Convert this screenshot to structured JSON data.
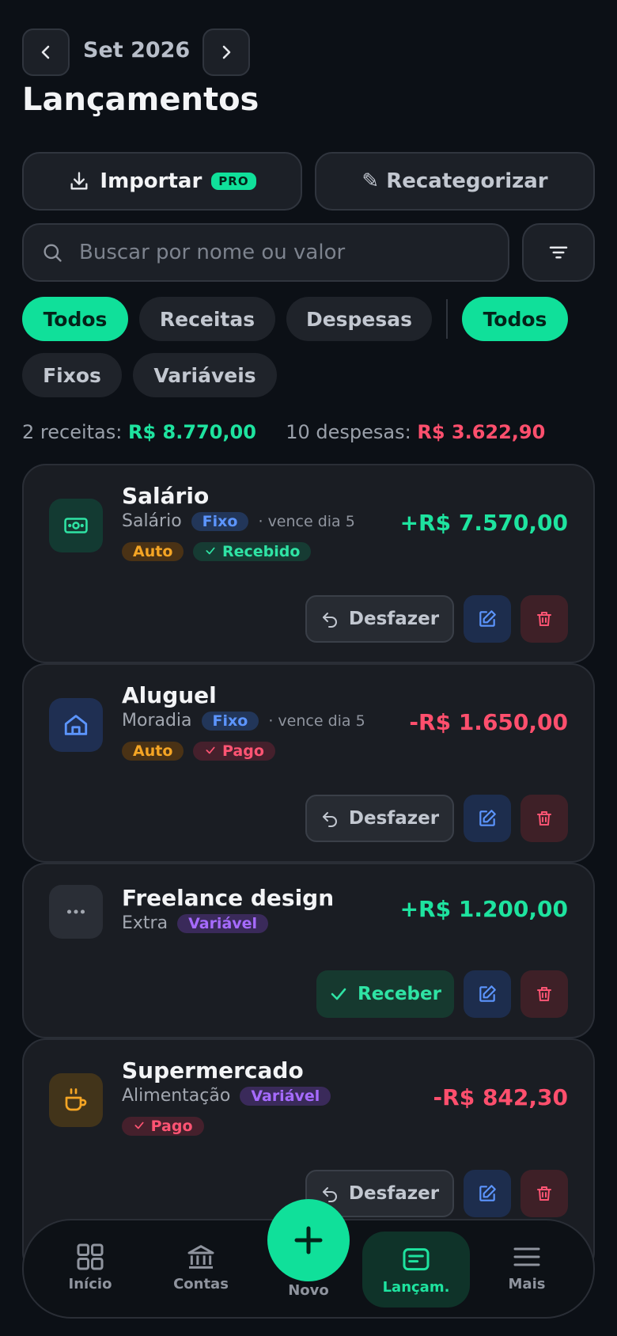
{
  "header": {
    "month": "Set 2026",
    "title": "Lançamentos"
  },
  "actions": {
    "import_label": "Importar",
    "pro_badge": "PRO",
    "recategorize_label": "✎ Recategorizar"
  },
  "search": {
    "placeholder": "Buscar por nome ou valor",
    "value": ""
  },
  "filters": {
    "type_chips": [
      "Todos",
      "Receitas",
      "Despesas"
    ],
    "type_selected": "Todos",
    "recurrence_chips": [
      "Todos",
      "Fixos",
      "Variáveis"
    ],
    "recurrence_selected": "Todos"
  },
  "summary": {
    "income_label": "2 receitas:",
    "income_value": "R$ 8.770,00",
    "expense_label": "10 despesas:",
    "expense_value": "R$ 3.622,90"
  },
  "transactions": [
    {
      "name": "Salário",
      "category": "Salário",
      "kind": "Fixo",
      "due": "· vence dia 5",
      "auto": "Auto",
      "status": "Recebido",
      "amount": "+R$ 7.570,00",
      "action": "Desfazer",
      "icon": "money-icon"
    },
    {
      "name": "Aluguel",
      "category": "Moradia",
      "kind": "Fixo",
      "due": "· vence dia 5",
      "auto": "Auto",
      "status": "Pago",
      "amount": "-R$ 1.650,00",
      "action": "Desfazer",
      "icon": "house-icon"
    },
    {
      "name": "Freelance design",
      "category": "Extra",
      "kind": "Variável",
      "amount": "+R$ 1.200,00",
      "action": "Receber",
      "icon": "dots-icon"
    },
    {
      "name": "Supermercado",
      "category": "Alimentação",
      "kind": "Variável",
      "status": "Pago",
      "amount": "-R$ 842,30",
      "action": "Desfazer",
      "icon": "cup-icon"
    }
  ],
  "nav": {
    "home": "Início",
    "accounts": "Contas",
    "new": "Novo",
    "entries": "Lançam.",
    "more": "Mais"
  },
  "colors": {
    "accent": "#10e09a",
    "income": "#1ee39f",
    "expense": "#ff4f6d",
    "background": "#0c1016",
    "card": "#1a1d23"
  }
}
